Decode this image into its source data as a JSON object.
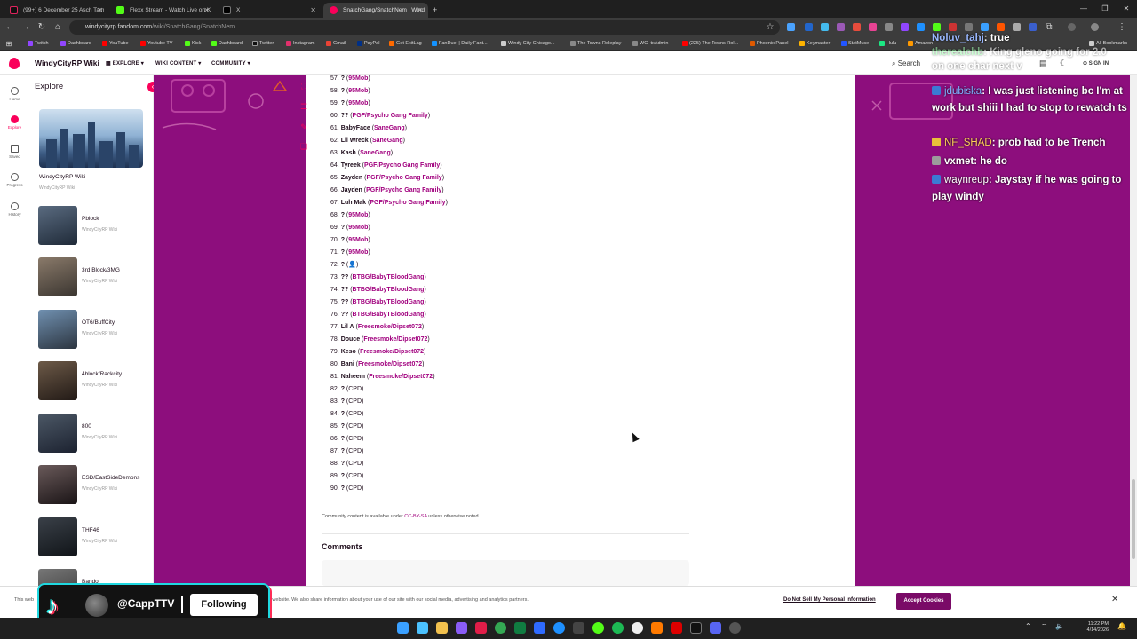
{
  "browser": {
    "tabs": [
      {
        "label": "(99+) 6 December 25 Asch Tam",
        "color": "#e0245e"
      },
      {
        "label": "Flexx Stream - Watch Live on K",
        "color": "#53fc18"
      },
      {
        "label": "X",
        "color": "#222222"
      },
      {
        "label": "SnatchGang/SnatchNem | Wind",
        "color": "#fa005a"
      }
    ],
    "url_host": "windycityrp.fandom.com",
    "url_path": "/wiki/SnatchGang/SnatchNem",
    "bookmarks": [
      {
        "label": "Twitch",
        "color": "#9146ff"
      },
      {
        "label": "Dashboard",
        "color": "#9146ff"
      },
      {
        "label": "YouTube",
        "color": "#ff0000"
      },
      {
        "label": "Youtube TV",
        "color": "#ff0000"
      },
      {
        "label": "Kick",
        "color": "#53fc18"
      },
      {
        "label": "Dashboard",
        "color": "#53fc18"
      },
      {
        "label": "Twitter",
        "color": "#111111"
      },
      {
        "label": "Instagram",
        "color": "#e1306c"
      },
      {
        "label": "Gmail",
        "color": "#ea4335"
      },
      {
        "label": "PayPal",
        "color": "#003087"
      },
      {
        "label": "Get ExitLag",
        "color": "#ff6a00"
      },
      {
        "label": "FanDuel | Daily Fant...",
        "color": "#1493ff"
      },
      {
        "label": "Windy City Chicago...",
        "color": "#cccccc"
      },
      {
        "label": "The Towns Roleplay",
        "color": "#888888"
      },
      {
        "label": "WC- txAdmin",
        "color": "#888888"
      },
      {
        "label": "(225) The Towns Rol...",
        "color": "#ff0000"
      },
      {
        "label": "Phoenix Panel",
        "color": "#e05a00"
      },
      {
        "label": "Keymaster",
        "color": "#ffb400"
      },
      {
        "label": "StatMuse",
        "color": "#2255ff"
      },
      {
        "label": "Hulu",
        "color": "#1ce783"
      },
      {
        "label": "Amazon",
        "color": "#ff9900"
      },
      {
        "label": "All Bookmarks",
        "color": "#cccccc"
      }
    ]
  },
  "fandom": {
    "wiki_name": "WindyCityRP Wiki",
    "nav": [
      "EXPLORE",
      "WIKI CONTENT",
      "COMMUNITY"
    ],
    "search_placeholder": "Search",
    "sign_in": "SIGN IN"
  },
  "rail": [
    {
      "label": "Home"
    },
    {
      "label": "Explore"
    },
    {
      "label": "Saved"
    },
    {
      "label": "Progress"
    },
    {
      "label": "History"
    }
  ],
  "explore": {
    "title": "Explore",
    "wiki_card": {
      "name": "WindyCityRP Wiki",
      "sub": "WindyCityRP Wiki"
    },
    "items": [
      {
        "name": "Pblock",
        "sub": "WindyCityRP Wiki"
      },
      {
        "name": "3rd Block/3MG",
        "sub": "WindyCityRP Wiki"
      },
      {
        "name": "OT6/BuffCity",
        "sub": "WindyCityRP Wiki"
      },
      {
        "name": "4block/Rackcity",
        "sub": "WindyCityRP Wiki"
      },
      {
        "name": "800",
        "sub": "WindyCityRP Wiki"
      },
      {
        "name": "ESD/EastSideDemons",
        "sub": "WindyCityRP Wiki"
      },
      {
        "name": "THF46",
        "sub": "WindyCityRP Wiki"
      },
      {
        "name": "Bando",
        "sub": ""
      }
    ]
  },
  "members": [
    {
      "num": "57.",
      "name": "?",
      "gang": "95Mob"
    },
    {
      "num": "58.",
      "name": "?",
      "gang": "95Mob"
    },
    {
      "num": "59.",
      "name": "?",
      "gang": "95Mob"
    },
    {
      "num": "60.",
      "name": "??",
      "gang": "PGF/Psycho Gang Family"
    },
    {
      "num": "61.",
      "name": "BabyFace",
      "gang": "SaneGang"
    },
    {
      "num": "62.",
      "name": "Lil Wreck",
      "gang": "SaneGang"
    },
    {
      "num": "63.",
      "name": "Kash",
      "gang": "SaneGang"
    },
    {
      "num": "64.",
      "name": "Tyreek",
      "gang": "PGF/Psycho Gang Family"
    },
    {
      "num": "65.",
      "name": "Zayden",
      "gang": "PGF/Psycho Gang Family"
    },
    {
      "num": "66.",
      "name": "Jayden",
      "gang": "PGF/Psycho Gang Family"
    },
    {
      "num": "67.",
      "name": "Luh Mak",
      "gang": "PGF/Psycho Gang Family"
    },
    {
      "num": "68.",
      "name": "?",
      "gang": "95Mob"
    },
    {
      "num": "69.",
      "name": "?",
      "gang": "95Mob"
    },
    {
      "num": "70.",
      "name": "?",
      "gang": "95Mob"
    },
    {
      "num": "71.",
      "name": "?",
      "gang": "95Mob"
    },
    {
      "num": "72.",
      "name": "?",
      "gang": "👤"
    },
    {
      "num": "73.",
      "name": "??",
      "gang": "BTBG/BabyTBloodGang"
    },
    {
      "num": "74.",
      "name": "??",
      "gang": "BTBG/BabyTBloodGang"
    },
    {
      "num": "75.",
      "name": "??",
      "gang": "BTBG/BabyTBloodGang"
    },
    {
      "num": "76.",
      "name": "??",
      "gang": "BTBG/BabyTBloodGang"
    },
    {
      "num": "77.",
      "name": "Lil A",
      "gang": "Freesmoke/Dipset072"
    },
    {
      "num": "78.",
      "name": "Douce",
      "gang": "Freesmoke/Dipset072"
    },
    {
      "num": "79.",
      "name": "Keso",
      "gang": "Freesmoke/Dipset072"
    },
    {
      "num": "80.",
      "name": "Bani",
      "gang": "Freesmoke/Dipset072"
    },
    {
      "num": "81.",
      "name": "Naheem",
      "gang": "Freesmoke/Dipset072"
    },
    {
      "num": "82.",
      "name": "?",
      "gang": "CPD",
      "plain": true
    },
    {
      "num": "83.",
      "name": "?",
      "gang": "CPD",
      "plain": true
    },
    {
      "num": "84.",
      "name": "?",
      "gang": "CPD",
      "plain": true
    },
    {
      "num": "85.",
      "name": "?",
      "gang": "CPD",
      "plain": true
    },
    {
      "num": "86.",
      "name": "?",
      "gang": "CPD",
      "plain": true
    },
    {
      "num": "87.",
      "name": "?",
      "gang": "CPD",
      "plain": true
    },
    {
      "num": "88.",
      "name": "?",
      "gang": "CPD",
      "plain": true
    },
    {
      "num": "89.",
      "name": "?",
      "gang": "CPD",
      "plain": true
    },
    {
      "num": "90.",
      "name": "?",
      "gang": "CPD",
      "plain": true
    }
  ],
  "license": {
    "prefix": "Community content is available under ",
    "link": "CC-BY-SA",
    "suffix": " unless otherwise noted."
  },
  "comments_title": "Comments",
  "chat": {
    "top": [
      {
        "user": "Noluv_tahj",
        "text": ": true"
      },
      {
        "user": "therealchb",
        "text": ": King gleno going for 2.0"
      },
      {
        "user": "",
        "text": "on one char next v"
      }
    ],
    "messages": [
      {
        "user": "jdubiska",
        "user_color": "#7fb2ff",
        "text": ": I was just listening bc I'm at work but shiii I had to stop to rewatch ts",
        "badge": "#3b7bd4"
      },
      {
        "user": "NF_SHAD",
        "user_color": "#ffcf5a",
        "text": ": prob had to be Trench",
        "badge": "#e8c03a"
      },
      {
        "user": "vxmet",
        "user_color": "#ffffff",
        "text": ": he do",
        "badge": "#9c9c9c"
      },
      {
        "user": "waynreup",
        "user_color": "#ffffff",
        "text": ": Jaystay if he was going to play windy",
        "badge": "#3b7bd4"
      }
    ]
  },
  "cookie": {
    "left_text": "This web",
    "text": "ur website. We also share information about your use of our site with our social media, advertising and analytics partners.",
    "dns": "Do Not Sell My Personal Information",
    "accept": "Accept Cookies"
  },
  "tiktok": {
    "handle": "@CappTTV",
    "button": "Following"
  },
  "clock": {
    "time": "11:22 PM",
    "date": "4/14/2026"
  }
}
